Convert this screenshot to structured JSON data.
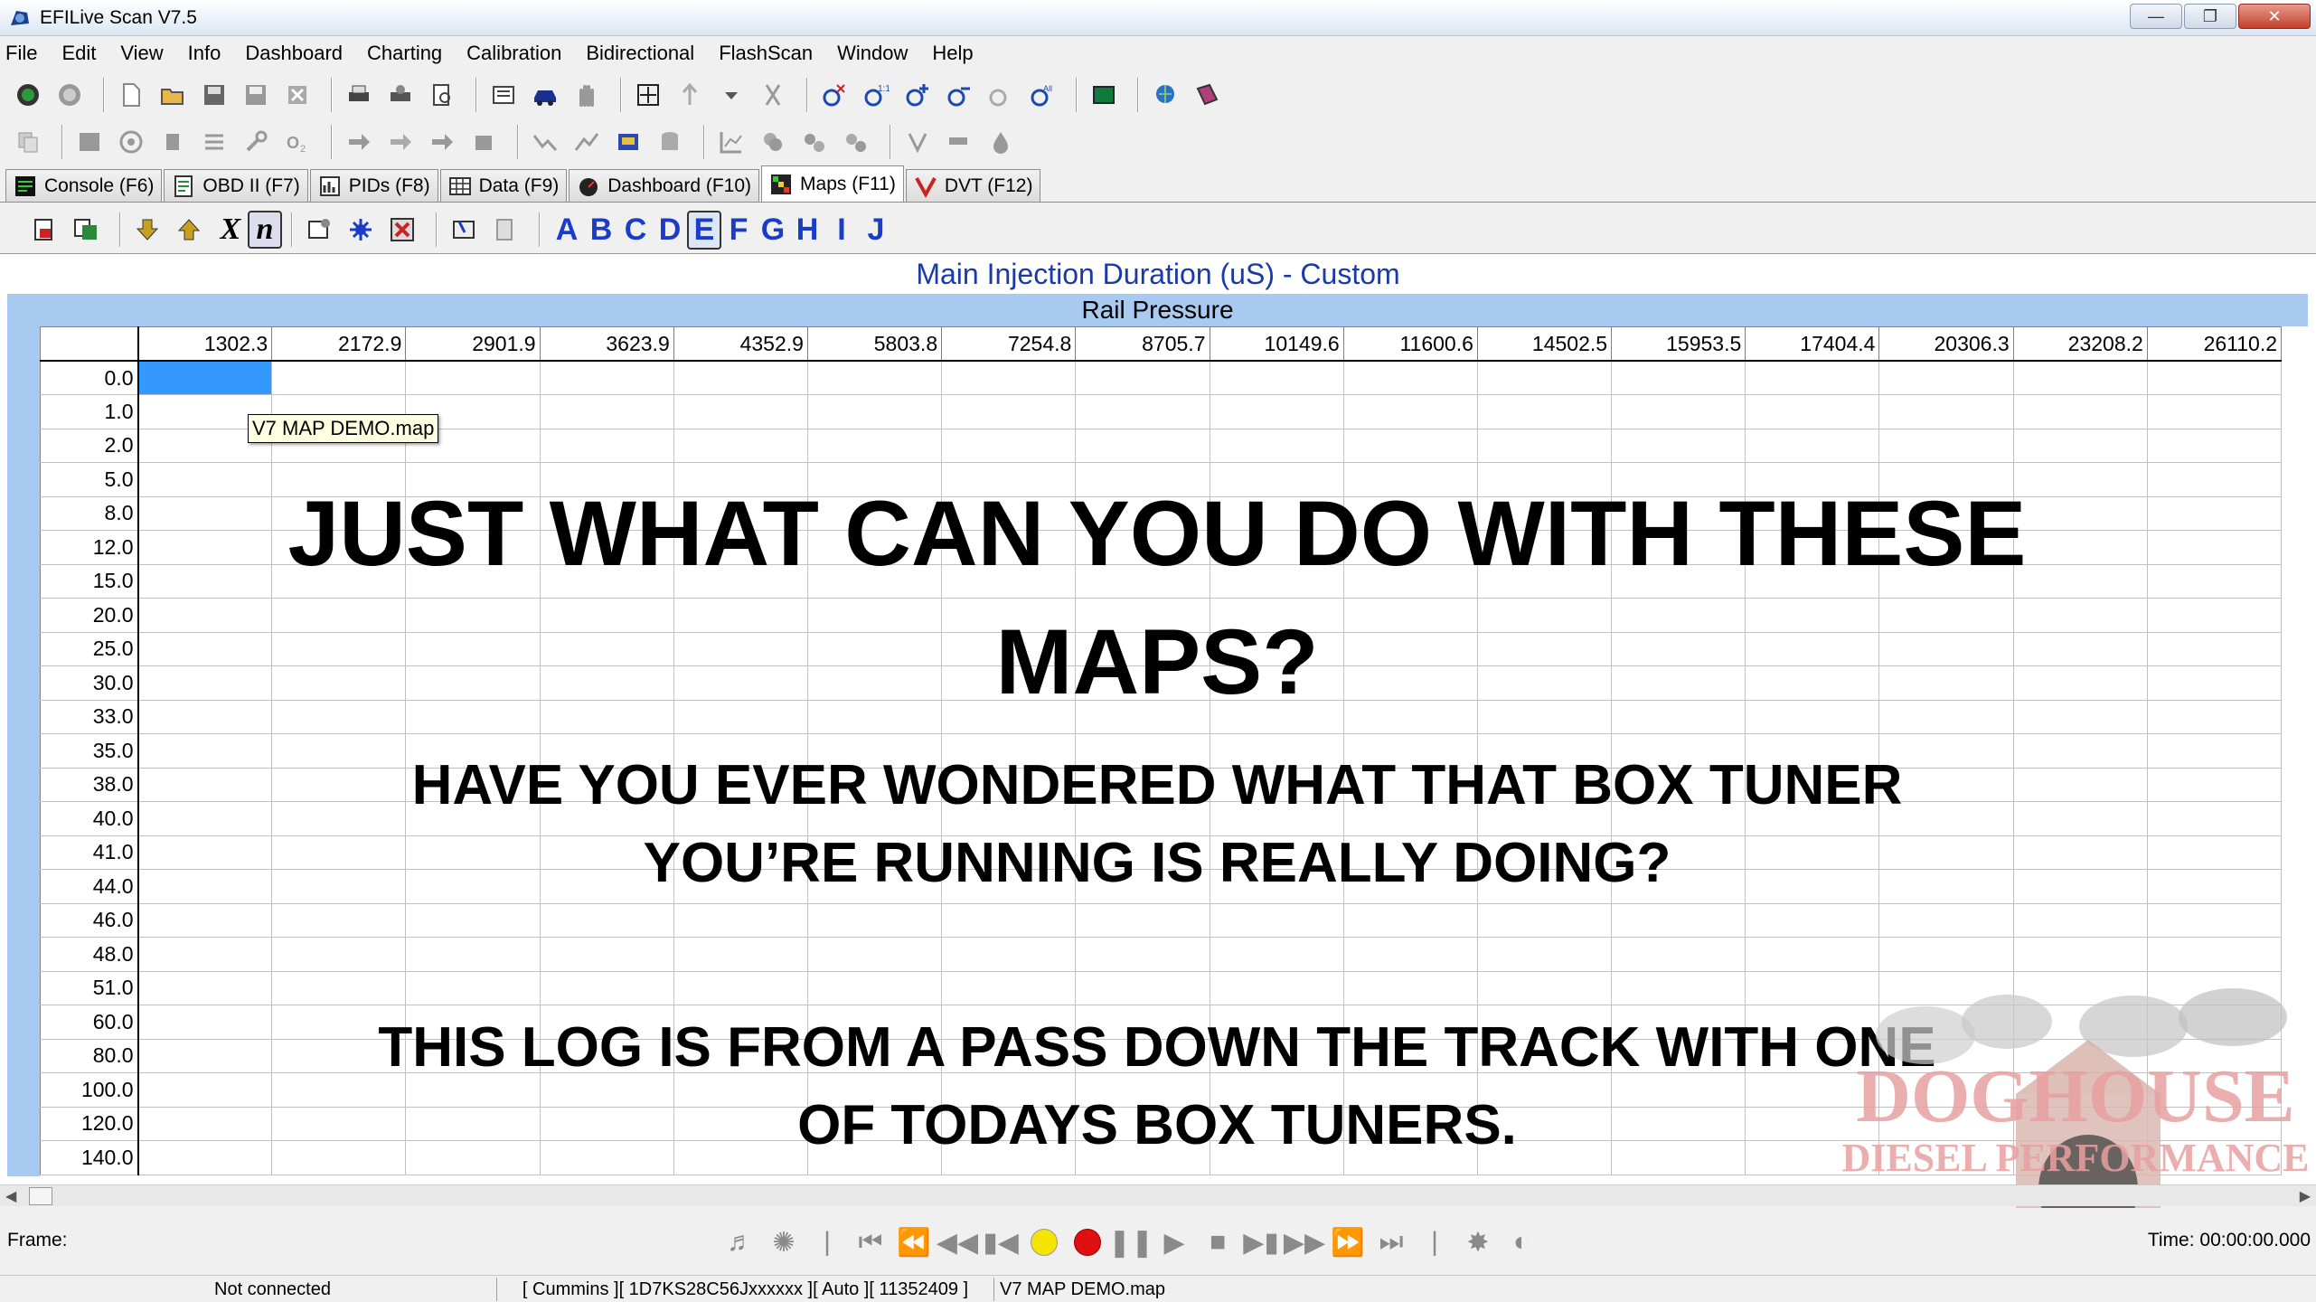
{
  "window": {
    "title": "EFILive Scan V7.5",
    "controls": [
      "minimize",
      "restore",
      "close"
    ]
  },
  "menu": [
    "File",
    "Edit",
    "View",
    "Info",
    "Dashboard",
    "Charting",
    "Calibration",
    "Bidirectional",
    "FlashScan",
    "Window",
    "Help"
  ],
  "tabs": [
    {
      "label": "Console (F6)",
      "icon": "console-icon"
    },
    {
      "label": "OBD II (F7)",
      "icon": "obd-icon"
    },
    {
      "label": "PIDs (F8)",
      "icon": "pids-icon"
    },
    {
      "label": "Data (F9)",
      "icon": "data-icon"
    },
    {
      "label": "Dashboard (F10)",
      "icon": "dashboard-icon"
    },
    {
      "label": "Maps (F11)",
      "icon": "maps-icon",
      "active": true
    },
    {
      "label": "DVT (F12)",
      "icon": "dvt-icon"
    }
  ],
  "map_toolbar": {
    "x_label": "X",
    "n_label": "n",
    "letters": [
      "A",
      "B",
      "C",
      "D",
      "E",
      "F",
      "G",
      "H",
      "I",
      "J"
    ],
    "active_letter": "E"
  },
  "map": {
    "title": "Main Injection Duration (uS) - Custom",
    "axis_title": "Rail Pressure",
    "columns": [
      "1302.3",
      "2172.9",
      "2901.9",
      "3623.9",
      "4352.9",
      "5803.8",
      "7254.8",
      "8705.7",
      "10149.6",
      "11600.6",
      "14502.5",
      "15953.5",
      "17404.4",
      "20306.3",
      "23208.2",
      "26110.2"
    ],
    "rows": [
      "0.0",
      "1.0",
      "2.0",
      "5.0",
      "8.0",
      "12.0",
      "15.0",
      "20.0",
      "25.0",
      "30.0",
      "33.0",
      "35.0",
      "38.0",
      "40.0",
      "41.0",
      "44.0",
      "46.0",
      "48.0",
      "51.0",
      "60.0",
      "80.0",
      "100.0",
      "120.0",
      "140.0"
    ],
    "tooltip": "V7 MAP DEMO.map"
  },
  "overlay": {
    "headline": "JUST WHAT CAN YOU DO WITH THESE MAPS?",
    "question": "HAVE YOU EVER WONDERED WHAT THAT BOX TUNER YOU’RE RUNNING IS REALLY DOING?",
    "note": "THIS LOG IS FROM A PASS DOWN THE TRACK WITH ONE OF TODAYS BOX TUNERS."
  },
  "logo": {
    "line1": "DOGHOUSE",
    "line2": "DIESEL PERFORMANCE",
    "color": "#e8a0a0"
  },
  "playback": {
    "frame_label": "Frame:",
    "time_label": "Time: 00:00:00.000"
  },
  "status": {
    "connection": "Not connected",
    "vehicle": "[ Cummins ][ 1D7KS28C56Jxxxxxx ][ Auto ][ 11352409 ]",
    "file": "V7 MAP DEMO.map"
  }
}
